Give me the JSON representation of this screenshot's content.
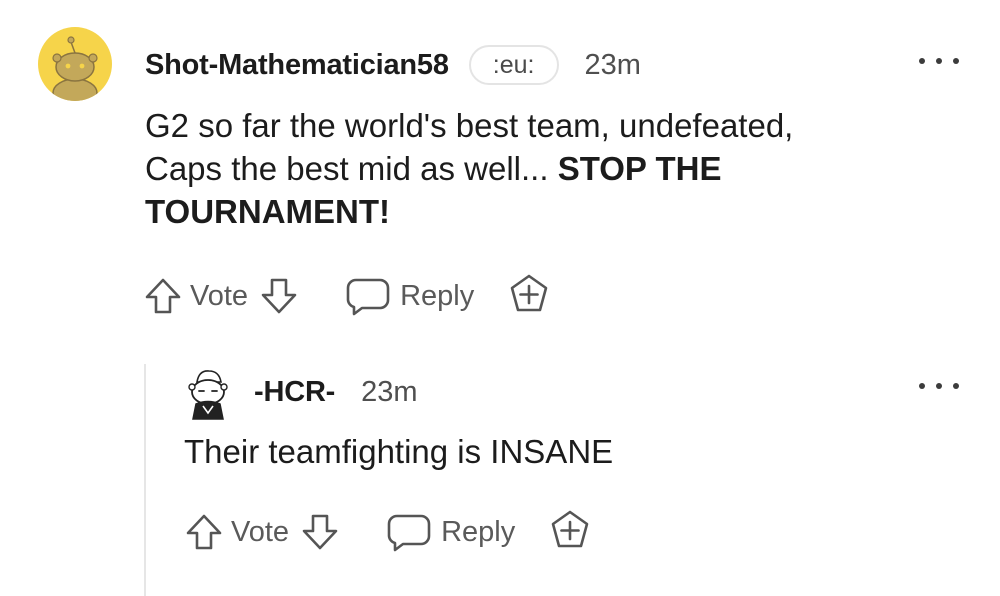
{
  "comment": {
    "username": "Shot-Mathematician58",
    "flair": ":eu:",
    "timestamp": "23m",
    "body_plain": "G2 so far the world's best team, undefeated, Caps the best mid as well... ",
    "body_bold": "STOP THE TOURNAMENT!",
    "avatar_icon": "snoo-avatar-icon",
    "avatar_color": "#f6d44a",
    "actions": {
      "vote_label": "Vote",
      "reply_label": "Reply"
    }
  },
  "reply": {
    "username": "-HCR-",
    "timestamp": "23m",
    "body": "Their teamfighting is INSANE",
    "avatar_icon": "custom-snoo-avatar-icon",
    "actions": {
      "vote_label": "Vote",
      "reply_label": "Reply"
    }
  },
  "icons": {
    "upvote": "upvote-arrow-icon",
    "downvote": "downvote-arrow-icon",
    "reply": "speech-bubble-icon",
    "award": "award-plus-icon",
    "more": "more-options-icon"
  }
}
